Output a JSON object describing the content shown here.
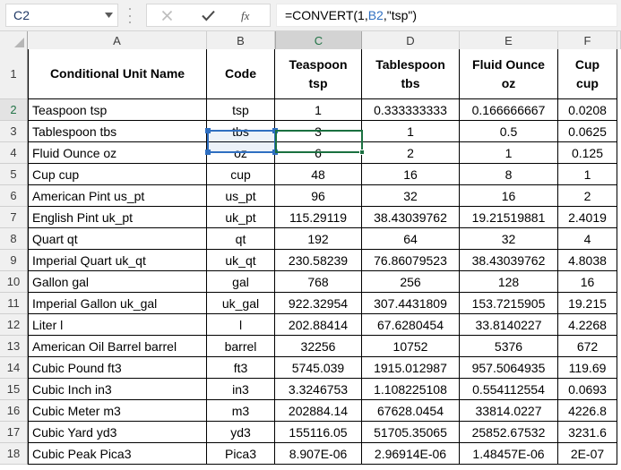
{
  "formula_bar": {
    "name_box_value": "C2",
    "name_box_icon": "chevron-down-icon",
    "cancel_icon": "close-icon",
    "enter_icon": "check-icon",
    "function_icon": "fx-icon",
    "formula_prefix": "=CONVERT(1,",
    "formula_reference": "B2",
    "formula_suffix": ",\"tsp\")"
  },
  "grid": {
    "column_headers": [
      "A",
      "B",
      "C",
      "D",
      "E",
      "F"
    ],
    "selected_column": "C",
    "selected_row": "2",
    "row_numbers": [
      "1",
      "2",
      "3",
      "4",
      "5",
      "6",
      "7",
      "8",
      "9",
      "10",
      "11",
      "12",
      "13",
      "14",
      "15",
      "16",
      "17",
      "18"
    ],
    "header_row": [
      {
        "line1": "Conditional Unit Name",
        "line2": ""
      },
      {
        "line1": "Code",
        "line2": ""
      },
      {
        "line1": "Teaspoon",
        "line2": "tsp"
      },
      {
        "line1": "Tablespoon",
        "line2": "tbs"
      },
      {
        "line1": "Fluid Ounce",
        "line2": "oz"
      },
      {
        "line1": "Cup",
        "line2": "cup"
      }
    ],
    "rows": [
      {
        "row": "2",
        "name": "Teaspoon tsp",
        "code": "tsp",
        "teaspoon": "1",
        "tablespoon": "0.333333333",
        "fluid_ounce": "0.166666667",
        "cup": "0.0208"
      },
      {
        "row": "3",
        "name": "Tablespoon tbs",
        "code": "tbs",
        "teaspoon": "3",
        "tablespoon": "1",
        "fluid_ounce": "0.5",
        "cup": "0.0625"
      },
      {
        "row": "4",
        "name": "Fluid Ounce oz",
        "code": "oz",
        "teaspoon": "6",
        "tablespoon": "2",
        "fluid_ounce": "1",
        "cup": "0.125"
      },
      {
        "row": "5",
        "name": "Cup cup",
        "code": "cup",
        "teaspoon": "48",
        "tablespoon": "16",
        "fluid_ounce": "8",
        "cup": "1"
      },
      {
        "row": "6",
        "name": "American Pint us_pt",
        "code": "us_pt",
        "teaspoon": "96",
        "tablespoon": "32",
        "fluid_ounce": "16",
        "cup": "2"
      },
      {
        "row": "7",
        "name": "English Pint uk_pt",
        "code": "uk_pt",
        "teaspoon": "115.29119",
        "tablespoon": "38.43039762",
        "fluid_ounce": "19.21519881",
        "cup": "2.4019"
      },
      {
        "row": "8",
        "name": "Quart qt",
        "code": "qt",
        "teaspoon": "192",
        "tablespoon": "64",
        "fluid_ounce": "32",
        "cup": "4"
      },
      {
        "row": "9",
        "name": "Imperial Quart uk_qt",
        "code": "uk_qt",
        "teaspoon": "230.58239",
        "tablespoon": "76.86079523",
        "fluid_ounce": "38.43039762",
        "cup": "4.8038"
      },
      {
        "row": "10",
        "name": "Gallon gal",
        "code": "gal",
        "teaspoon": "768",
        "tablespoon": "256",
        "fluid_ounce": "128",
        "cup": "16"
      },
      {
        "row": "11",
        "name": "Imperial Gallon uk_gal",
        "code": "uk_gal",
        "teaspoon": "922.32954",
        "tablespoon": "307.4431809",
        "fluid_ounce": "153.7215905",
        "cup": "19.215"
      },
      {
        "row": "12",
        "name": "Liter l",
        "code": "l",
        "teaspoon": "202.88414",
        "tablespoon": "67.6280454",
        "fluid_ounce": "33.8140227",
        "cup": "4.2268"
      },
      {
        "row": "13",
        "name": "American Oil Barrel barrel",
        "code": "barrel",
        "teaspoon": "32256",
        "tablespoon": "10752",
        "fluid_ounce": "5376",
        "cup": "672"
      },
      {
        "row": "14",
        "name": "Cubic Pound ft3",
        "code": "ft3",
        "teaspoon": "5745.039",
        "tablespoon": "1915.012987",
        "fluid_ounce": "957.5064935",
        "cup": "119.69"
      },
      {
        "row": "15",
        "name": "Cubic Inch in3",
        "code": "in3",
        "teaspoon": "3.3246753",
        "tablespoon": "1.108225108",
        "fluid_ounce": "0.554112554",
        "cup": "0.0693"
      },
      {
        "row": "16",
        "name": "Cubic Meter m3",
        "code": "m3",
        "teaspoon": "202884.14",
        "tablespoon": "67628.0454",
        "fluid_ounce": "33814.0227",
        "cup": "4226.8"
      },
      {
        "row": "17",
        "name": "Cubic Yard yd3",
        "code": "yd3",
        "teaspoon": "155116.05",
        "tablespoon": "51705.35065",
        "fluid_ounce": "25852.67532",
        "cup": "3231.6"
      },
      {
        "row": "18",
        "name": "Cubic Peak Pica3",
        "code": "Pica3",
        "teaspoon": "8.907E-06",
        "tablespoon": "2.96914E-06",
        "fluid_ounce": "1.48457E-06",
        "cup": "2E-07"
      }
    ]
  },
  "colors": {
    "selection_green": "#1a7040",
    "reference_blue": "#2f6fc1",
    "header_gray": "#f0f0f0"
  }
}
